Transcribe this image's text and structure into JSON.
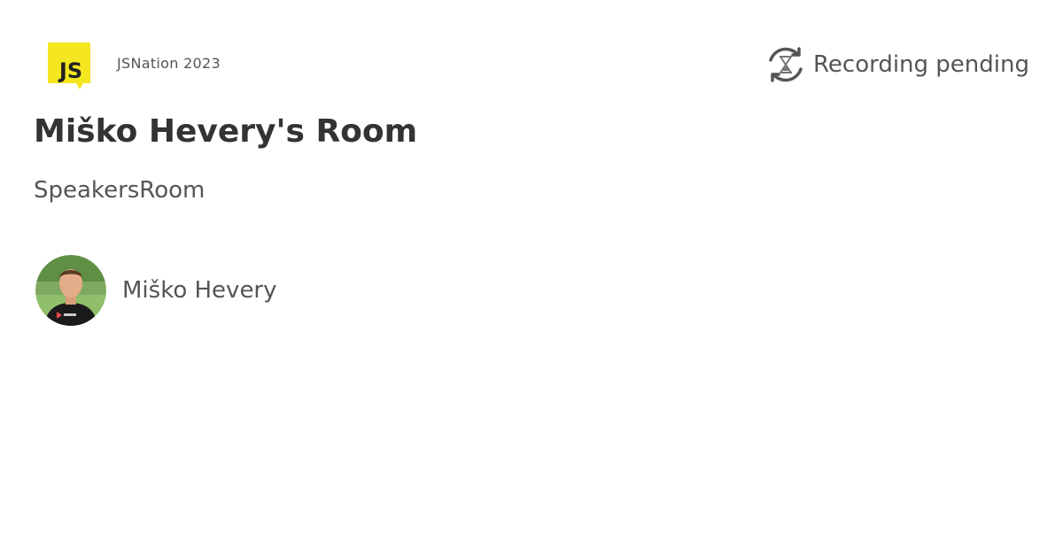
{
  "event": {
    "name": "JSNation 2023",
    "logo_text": "JS",
    "logo_color": "#f5e71f"
  },
  "status": {
    "label": "Recording pending",
    "icon": "hourglass-refresh-icon"
  },
  "room": {
    "title": "Miško Hevery's Room",
    "type": "SpeakersRoom"
  },
  "speakers": [
    {
      "name": "Miško Hevery",
      "avatar_icon": "avatar-photo"
    }
  ],
  "colors": {
    "text_dark": "#333333",
    "text_muted": "#555555",
    "background": "#ffffff",
    "brand_yellow": "#f5e71f"
  }
}
